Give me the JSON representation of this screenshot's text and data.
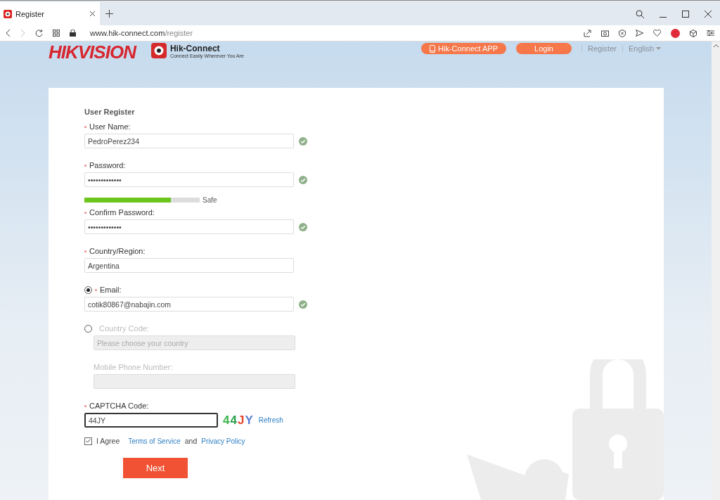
{
  "browser": {
    "tab_title": "Register",
    "url_host": "www.hik-connect.com",
    "url_path": "/register"
  },
  "header": {
    "brand": "HIKVISION",
    "app_name": "Hik-Connect",
    "app_tagline": "Connect Easily Wherever You Are",
    "app_button": "Hik-Connect APP",
    "login": "Login",
    "register": "Register",
    "language": "English"
  },
  "form": {
    "title": "User Register",
    "fields": [
      {
        "kind": "text",
        "label": "User Name:",
        "required": true,
        "value": "PedroPerez234",
        "valid": true
      },
      {
        "kind": "password",
        "label": "Password:",
        "required": true,
        "value": "•••••••••••••",
        "valid": true
      },
      {
        "kind": "meter",
        "level": 0.75,
        "label": "Safe"
      },
      {
        "kind": "password",
        "label": "Confirm Password:",
        "required": true,
        "value": "•••••••••••••",
        "valid": true
      },
      {
        "kind": "text",
        "label": "Country/Region:",
        "required": true,
        "value": "Argentina",
        "valid": false
      }
    ],
    "contact_options": [
      {
        "selected": true,
        "fields": [
          {
            "label": "Email:",
            "required": true,
            "value": "cotik80867@nabajin.com",
            "valid": true
          }
        ]
      },
      {
        "selected": false,
        "fields": [
          {
            "label": "Country Code:",
            "required": false,
            "placeholder": "Please choose your country",
            "valid": false
          },
          {
            "label": "Mobile Phone Number:",
            "required": false,
            "valid": false
          }
        ]
      }
    ],
    "captcha": {
      "label": "CAPTCHA Code:",
      "required": true,
      "value": "44JY",
      "image_text": "44JY",
      "refresh": "Refresh"
    },
    "agreement": {
      "checked": true,
      "label": "I Agree",
      "terms": "Terms of Service",
      "joiner": "and",
      "privacy": "Privacy Policy"
    },
    "submit": "Next"
  }
}
